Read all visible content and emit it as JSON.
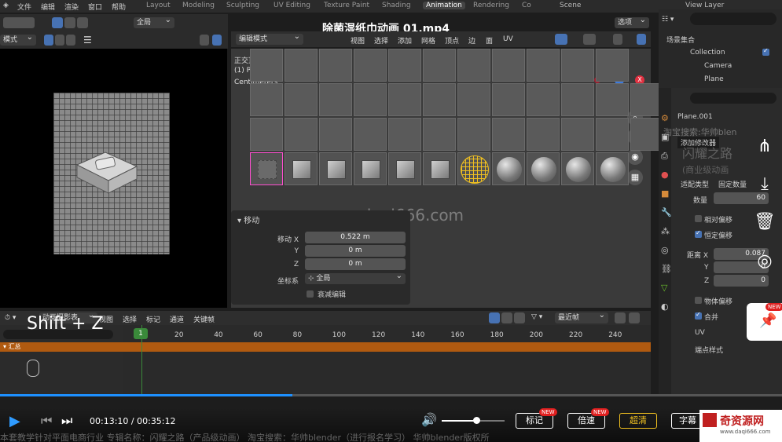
{
  "top_menu": [
    "文件",
    "编辑",
    "渲染",
    "窗口",
    "帮助"
  ],
  "workspace_tabs": [
    "Layout",
    "Modeling",
    "Sculpting",
    "UV Editing",
    "Texture Paint",
    "Shading",
    "Animation",
    "Rendering",
    "Co"
  ],
  "active_tab": "Animation",
  "scene_label": "Scene",
  "view_layer_label": "View Layer",
  "video_title": "除菌湿纸巾动画 01.mp4",
  "left_toolbar": {
    "mode": "模式",
    "orientation": "全局"
  },
  "viewport_header": {
    "mode": "编辑模式",
    "menus": [
      "视图",
      "选择",
      "添加",
      "网格",
      "顶点",
      "边",
      "面",
      "UV"
    ],
    "options": "选项"
  },
  "viewport_overlay": {
    "view_name": "正交顶视图",
    "object": "(1) Plane.001",
    "units": "Centimeters"
  },
  "watermark_url": "www.daqi666.com",
  "move_panel": {
    "title": "移动",
    "rows": [
      {
        "label": "移动 X",
        "value": "0.522 m"
      },
      {
        "label": "Y",
        "value": "0 m"
      },
      {
        "label": "Z",
        "value": "0 m"
      }
    ],
    "coord_label": "坐标系",
    "coord_value": "全局",
    "proportional": "衰减编辑"
  },
  "outliner": {
    "title": "场景集合",
    "items": [
      "Collection",
      "Camera",
      "Plane"
    ]
  },
  "properties": {
    "object_name": "Plane.001",
    "promo_text": "淘宝搜索:华帅blen",
    "add_modifier": "添加修改器",
    "brand_overlay": "闪耀之路",
    "sub_overlay": "(商业级动画",
    "fit_type_label": "适配类型",
    "fit_type_value": "固定数量",
    "count_label": "数量",
    "count_value": "60",
    "relative_offset": "相对偏移",
    "constant_offset": "恒定偏移",
    "distance_label": "距离 X",
    "distance_x": "0.087",
    "y_label": "Y",
    "y_value": "0",
    "z_label": "Z",
    "z_value": "0",
    "object_offset": "物体偏移",
    "merge": "合并",
    "uv": "UV",
    "caps": "端点样式"
  },
  "timeline": {
    "mode": "动画摄影表",
    "menus": [
      "视图",
      "选择",
      "标记",
      "通道",
      "关键帧"
    ],
    "filter": "最近帧",
    "current_frame": "1",
    "ticks": [
      "20",
      "40",
      "60",
      "80",
      "100",
      "120",
      "140",
      "160",
      "180",
      "200",
      "220",
      "240"
    ],
    "summary": "汇总"
  },
  "key_overlay": "Shift + Z",
  "video_controls": {
    "time_current": "00:13:10",
    "time_total": "00:35:12",
    "progress": 0.374,
    "volume": 0.55,
    "btn_mark": "标记",
    "btn_speed": "倍速",
    "btn_quality": "超清",
    "btn_sub": "字幕",
    "new_badge": "NEW"
  },
  "bottom_marquee": "本套教学针对平面电商行业   专辑名称：闪耀之路（产品级动画）  淘宝搜索：华帅blender（进行报名学习） 华帅blender版权所",
  "site_logo": "奇资源网",
  "site_url": "www.daqi666.com",
  "colors": {
    "accent": "#4772b3",
    "highlight": "#f0c020",
    "progress": "#1e90ff",
    "timeline_summary": "#b05a10"
  }
}
